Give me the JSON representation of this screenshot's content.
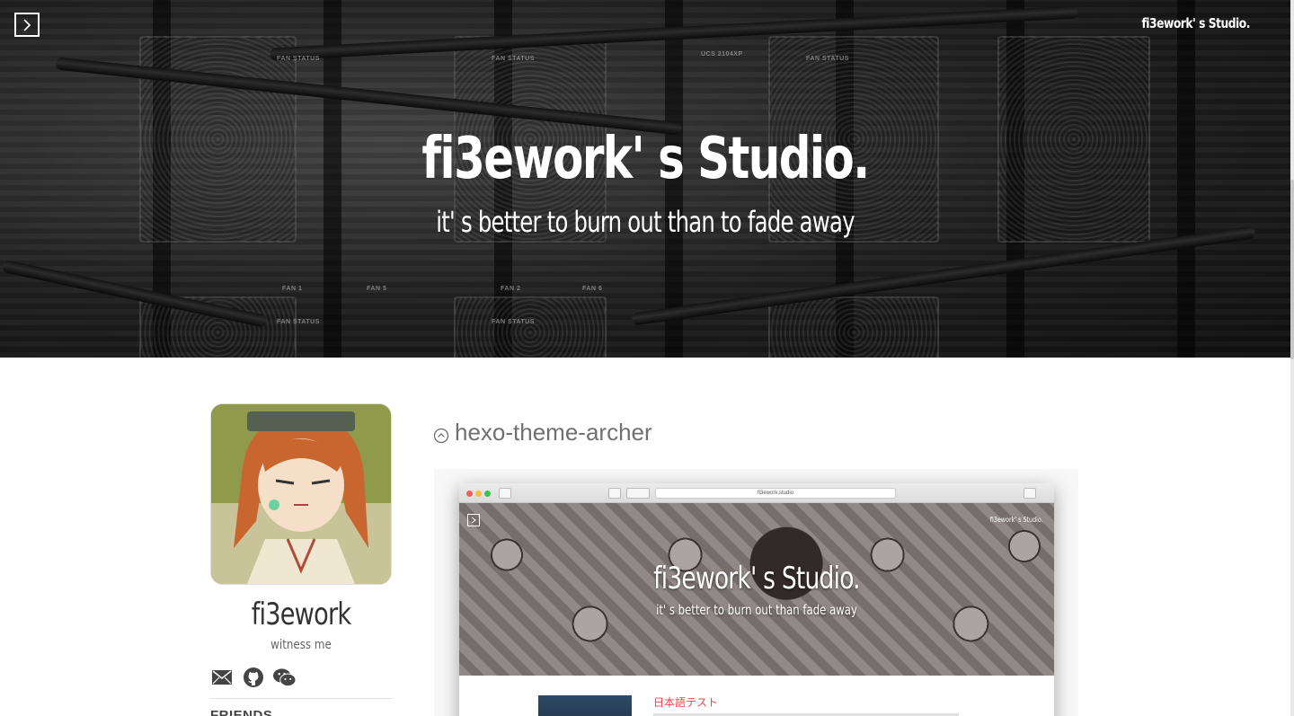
{
  "header": {
    "site_name_small": "fi3ework' s Studio.",
    "title": "fi3ework' s Studio.",
    "subtitle": "it' s better to burn out than to fade away",
    "banner_tags": [
      "FAN STATUS",
      "FAN STATUS",
      "UCS 2104XP",
      "FAN STATUS",
      "FAN 1",
      "FAN 5",
      "FAN 2",
      "FAN 6",
      "FAN STATUS",
      "FAN STATUS"
    ]
  },
  "sidebar": {
    "name": "fi3ework",
    "motto": "witness me",
    "social": [
      "mail-icon",
      "github-icon",
      "wechat-icon"
    ],
    "section_heading": "FRIENDS"
  },
  "post": {
    "title": "hexo-theme-archer",
    "screenshot": {
      "url": "fi3ework.studio",
      "site_name_small": "fi3ework' s Studio.",
      "title": "fi3ework' s Studio.",
      "subtitle": "it' s better to burn out than fade away",
      "post_title": "日本語テスト"
    }
  },
  "colors": {
    "banner_bg": "#2a2a2a",
    "accent_red": "#e8454a",
    "text_gray": "#707070"
  }
}
